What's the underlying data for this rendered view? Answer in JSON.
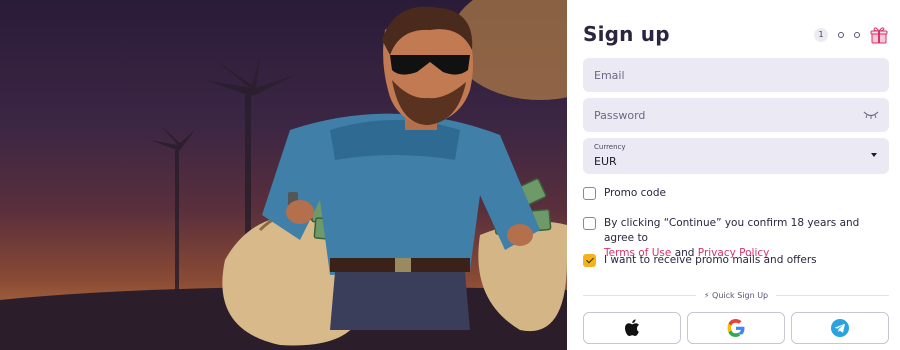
{
  "header": {
    "title": "Sign up",
    "step_current": "1"
  },
  "form": {
    "email_placeholder": "Email",
    "password_placeholder": "Password",
    "currency_label": "Currency",
    "currency_value": "EUR",
    "promo_label": "Promo code",
    "terms_text": "By clicking “Continue” you confirm 18 years and agree to",
    "terms_link": "Terms of Use",
    "terms_and": "and",
    "privacy_link": "Privacy Policy",
    "promo_mails_label": "I want to receive promo mails and offers",
    "promo_mails_checked": true
  },
  "quick_signup": {
    "label": "⚡ Quick Sign Up",
    "providers": [
      "apple-icon",
      "google-icon",
      "telegram-icon"
    ]
  },
  "colors": {
    "accent_yellow": "#f5b31b",
    "link_pink": "#d6336c",
    "field_bg": "#ebe9f3",
    "title": "#2b2540"
  }
}
